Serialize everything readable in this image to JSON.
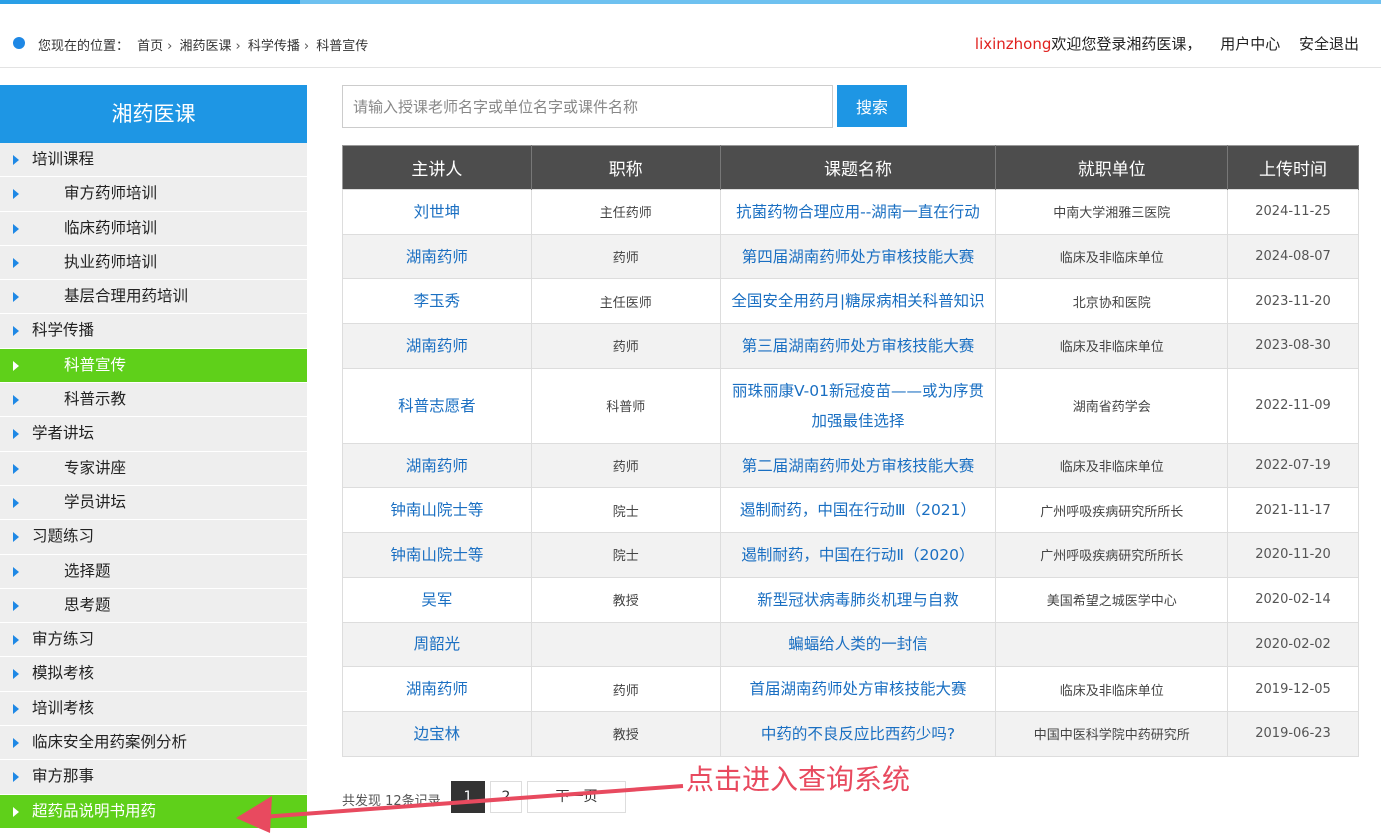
{
  "header": {
    "location_label": "您现在的位置：",
    "breadcrumb": [
      "首页",
      "湘药医课",
      "科学传播",
      "科普宣传"
    ],
    "username": "lixinzhong",
    "welcome": "欢迎您登录湘药医课，",
    "user_center": "用户中心",
    "logout": "安全退出"
  },
  "sidebar": {
    "title": "湘药医课",
    "items": [
      {
        "label": "培训课程",
        "level": 1
      },
      {
        "label": "审方药师培训",
        "level": 2
      },
      {
        "label": "临床药师培训",
        "level": 2
      },
      {
        "label": "执业药师培训",
        "level": 2
      },
      {
        "label": "基层合理用药培训",
        "level": 2
      },
      {
        "label": "科学传播",
        "level": 1
      },
      {
        "label": "科普宣传",
        "level": 2,
        "active": true
      },
      {
        "label": "科普示教",
        "level": 2
      },
      {
        "label": "学者讲坛",
        "level": 1
      },
      {
        "label": "专家讲座",
        "level": 2
      },
      {
        "label": "学员讲坛",
        "level": 2
      },
      {
        "label": "习题练习",
        "level": 1
      },
      {
        "label": "选择题",
        "level": 2
      },
      {
        "label": "思考题",
        "level": 2
      },
      {
        "label": "审方练习",
        "level": 1
      },
      {
        "label": "模拟考核",
        "level": 1
      },
      {
        "label": "培训考核",
        "level": 1
      },
      {
        "label": "临床安全用药案例分析",
        "level": 1
      },
      {
        "label": "审方那事",
        "level": 1
      },
      {
        "label": "超药品说明书用药",
        "level": 1,
        "active": true
      }
    ]
  },
  "search": {
    "placeholder": "请输入授课老师名字或单位名字或课件名称",
    "button": "搜索"
  },
  "table": {
    "headers": [
      "主讲人",
      "职称",
      "课题名称",
      "就职单位",
      "上传时间"
    ],
    "rows": [
      {
        "speaker": "刘世坤",
        "title": "主任药师",
        "topic": "抗菌药物合理应用--湖南一直在行动",
        "org": "中南大学湘雅三医院",
        "date": "2024-11-25"
      },
      {
        "speaker": "湖南药师",
        "title": "药师",
        "topic": "第四届湖南药师处方审核技能大赛",
        "org": "临床及非临床单位",
        "date": "2024-08-07"
      },
      {
        "speaker": "李玉秀",
        "title": "主任医师",
        "topic": "全国安全用药月|糖尿病相关科普知识",
        "org": "北京协和医院",
        "date": "2023-11-20"
      },
      {
        "speaker": "湖南药师",
        "title": "药师",
        "topic": "第三届湖南药师处方审核技能大赛",
        "org": "临床及非临床单位",
        "date": "2023-08-30"
      },
      {
        "speaker": "科普志愿者",
        "title": "科普师",
        "topic": "丽珠丽康V-01新冠疫苗——或为序贯加强最佳选择",
        "org": "湖南省药学会",
        "date": "2022-11-09"
      },
      {
        "speaker": "湖南药师",
        "title": "药师",
        "topic": "第二届湖南药师处方审核技能大赛",
        "org": "临床及非临床单位",
        "date": "2022-07-19"
      },
      {
        "speaker": "钟南山院士等",
        "title": "院士",
        "topic": "遏制耐药，中国在行动Ⅲ（2021）",
        "org": "广州呼吸疾病研究所所长",
        "date": "2021-11-17"
      },
      {
        "speaker": "钟南山院士等",
        "title": "院士",
        "topic": "遏制耐药，中国在行动Ⅱ（2020）",
        "org": "广州呼吸疾病研究所所长",
        "date": "2020-11-20"
      },
      {
        "speaker": "吴军",
        "title": "教授",
        "topic": "新型冠状病毒肺炎机理与自救",
        "org": "美国希望之城医学中心",
        "date": "2020-02-14"
      },
      {
        "speaker": "周韶光",
        "title": "",
        "topic": "蝙蝠给人类的一封信",
        "org": "",
        "date": "2020-02-02"
      },
      {
        "speaker": "湖南药师",
        "title": "药师",
        "topic": "首届湖南药师处方审核技能大赛",
        "org": "临床及非临床单位",
        "date": "2019-12-05"
      },
      {
        "speaker": "边宝林",
        "title": "教授",
        "topic": "中药的不良反应比西药少吗?",
        "org": "中国中医科学院中药研究所",
        "date": "2019-06-23"
      }
    ]
  },
  "pagination": {
    "summary": "共发现 12条记录",
    "pages": [
      "1",
      "2"
    ],
    "next": "下一页"
  },
  "annotation": {
    "text": "点击进入查询系统",
    "color": "#e84a5f"
  },
  "colors": {
    "accent": "#1e96e4",
    "active_green": "#5fd01a",
    "link": "#1a6fc2",
    "username_red": "#e0211f"
  }
}
